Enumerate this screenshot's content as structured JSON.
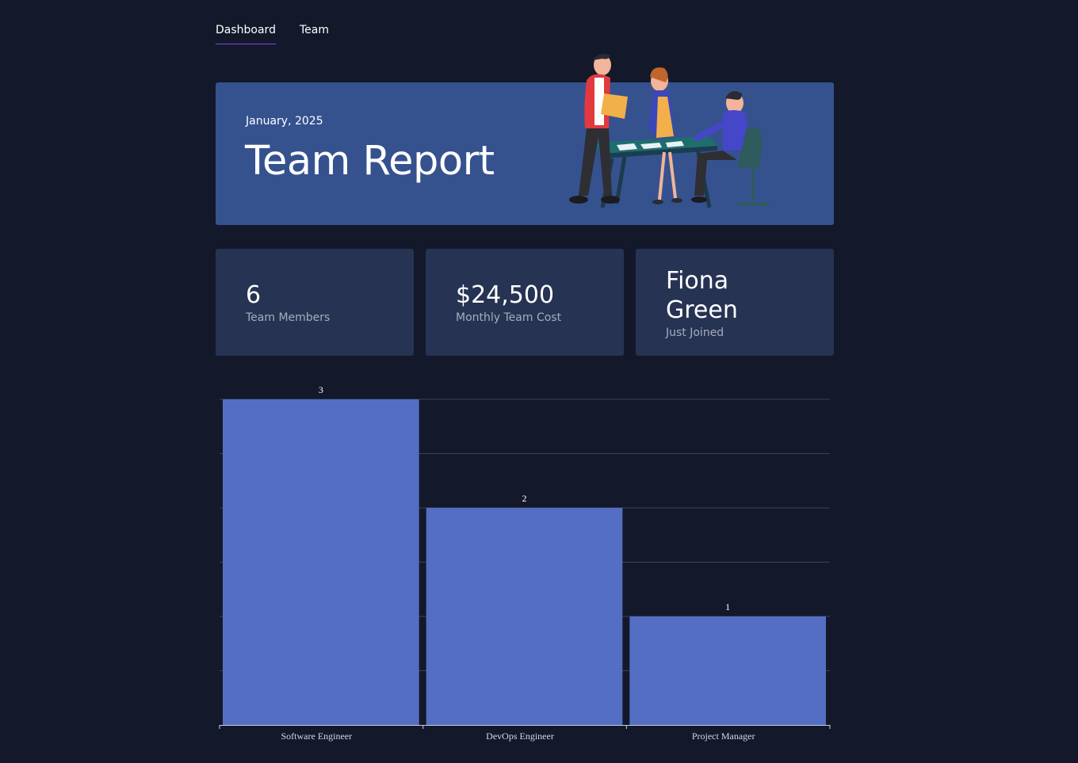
{
  "nav": {
    "items": [
      {
        "label": "Dashboard",
        "active": true
      },
      {
        "label": "Team",
        "active": false
      }
    ],
    "active_underline_color": "#8b3ff2"
  },
  "hero": {
    "date": "January, 2025",
    "title": "Team Report",
    "background_color": "#35528f",
    "illustration": "team-meeting-illustration"
  },
  "stats": [
    {
      "value": "6",
      "label": "Team Members"
    },
    {
      "value": "$24,500",
      "label": "Monthly Team Cost"
    },
    {
      "value": "Fiona Green",
      "label": "Just Joined"
    }
  ],
  "colors": {
    "page_background": "#13192a",
    "card_background": "#263353",
    "bar_color": "#546ec4"
  },
  "chart_data": {
    "type": "bar",
    "categories": [
      "Software Engineer",
      "DevOps Engineer",
      "Project Manager"
    ],
    "values": [
      3,
      2,
      1
    ],
    "ylim": [
      0,
      3
    ],
    "grid": true,
    "show_value_labels": true,
    "title": "",
    "xlabel": "",
    "ylabel": ""
  }
}
